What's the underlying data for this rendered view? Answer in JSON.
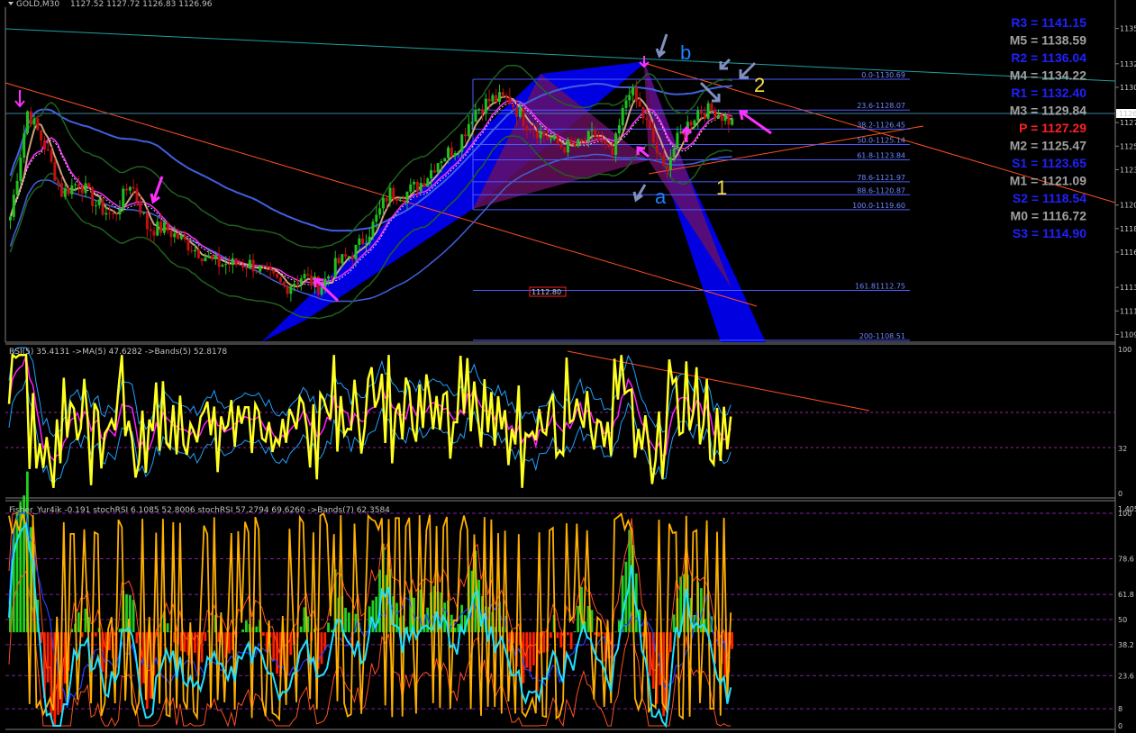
{
  "header": {
    "menu_icon": "triangle-down-icon",
    "symbol": "GOLD,M30",
    "ohlc": "1127.52 1127.72 1126.83 1126.96"
  },
  "price_axis": {
    "labels": [
      "1135",
      "1132",
      "1130",
      "1127",
      "1125",
      "1123",
      "1120",
      "1118",
      "1116",
      "1113",
      "1111",
      "1109"
    ],
    "current": "1126"
  },
  "pivots": [
    {
      "text": "R3 = 1141.15",
      "color": "#2020ff"
    },
    {
      "text": "M5 = 1138.59",
      "color": "#a0a0a0"
    },
    {
      "text": "R2 = 1136.04",
      "color": "#2020ff"
    },
    {
      "text": "M4 = 1134.22",
      "color": "#a0a0a0"
    },
    {
      "text": "R1 = 1132.40",
      "color": "#2020ff"
    },
    {
      "text": "M3 = 1129.84",
      "color": "#a0a0a0"
    },
    {
      "text": "P = 1127.29",
      "color": "#ff2020"
    },
    {
      "text": "M2 = 1125.47",
      "color": "#a0a0a0"
    },
    {
      "text": "S1 = 1123.65",
      "color": "#2020ff"
    },
    {
      "text": "M1 = 1121.09",
      "color": "#a0a0a0"
    },
    {
      "text": "S2 = 1118.54",
      "color": "#2020ff"
    },
    {
      "text": "M0 = 1116.72",
      "color": "#a0a0a0"
    },
    {
      "text": "S3 = 1114.90",
      "color": "#2020ff"
    }
  ],
  "fib_levels": [
    "0.0-1130.69",
    "23.6-1128.07",
    "38.2-1126.45",
    "50.0-1125.14",
    "61.8-1123.84",
    "78.6-1121.97",
    "88.6-1120.87",
    "100.0-1119.60",
    "161.81112.75",
    "200-1108.51"
  ],
  "price_box": "1112.80",
  "wave_labels": {
    "a": "a",
    "b": "b",
    "one": "1",
    "two": "2"
  },
  "rsi_panel": {
    "title": "RSI(5) 35.4131  ->MA(5) 47.6282  ->Bands(5) 52.8178",
    "axis": [
      "100",
      "32",
      "0"
    ]
  },
  "fisher_panel": {
    "title": "Fisher_Yur4ik -0.191  stochRSI 6.1085 52.8006  stochRSI 57.2794 69.6260  ->Bands(7) 62.3584",
    "axis": [
      "1.4055",
      "100",
      "78.6",
      "61.8",
      "50",
      "38.2",
      "23.6",
      "8",
      "0"
    ]
  },
  "colors": {
    "rsi": "#ffff20",
    "rsi_ma": "#ff20ff",
    "bands": "#20a0ff",
    "histogram_pos": "#20d020",
    "histogram_neg": "#ff2000",
    "stoch": "#ffb000",
    "stoch_rsi": "#20e0ff",
    "pattern": "#0000ff",
    "pattern_fill": "#800040"
  },
  "chart_data": [
    {
      "type": "candlestick",
      "title": "GOLD,M30",
      "ylim": [
        1108.5,
        1136.5
      ],
      "approx_close_path": [
        1119,
        1128,
        1125,
        1121,
        1122,
        1120,
        1119,
        1122,
        1118,
        1118,
        1117,
        1116,
        1115,
        1115,
        1115,
        1114,
        1113,
        1114,
        1113,
        1115,
        1116,
        1118,
        1121,
        1121,
        1122,
        1124,
        1125,
        1128,
        1129,
        1129,
        1127,
        1126,
        1125,
        1125,
        1126,
        1124,
        1130,
        1127,
        1123,
        1126,
        1128,
        1128,
        1127
      ]
    },
    {
      "type": "line",
      "title": "RSI(5) 35.4131  ->MA(5) 47.6282  ->Bands(5) 52.8178",
      "ylim": [
        0,
        100
      ],
      "levels": [
        70,
        32
      ]
    },
    {
      "type": "bar",
      "title": "Fisher_Yur4ik -0.191  stochRSI 6.1085 52.8006  stochRSI 57.2794 69.6260  ->Bands(7) 62.3584",
      "ylim": [
        0,
        100
      ],
      "levels": [
        100,
        78.6,
        61.8,
        50,
        38.2,
        23.6,
        8
      ]
    }
  ]
}
